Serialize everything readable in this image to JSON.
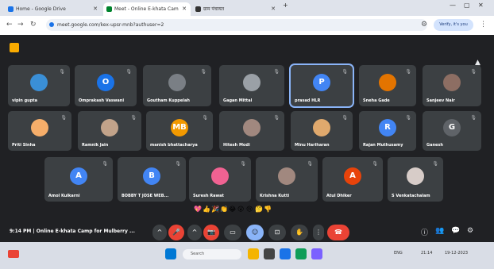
{
  "browser": {
    "tabs": [
      {
        "label": "Home - Google Drive",
        "fav_color": "#1a73e8"
      },
      {
        "label": "Meet - Online E-khata Cam",
        "fav_color": "#00832d"
      },
      {
        "label": "ग्राम पंचायत",
        "fav_color": "#333333"
      }
    ],
    "url": "meet.google.com/kex-upsr-mnb?authuser=2",
    "profile": "Verify, it's you"
  },
  "participants": [
    {
      "name": "vipin gupta",
      "initial": "",
      "color": "#3a8fd6"
    },
    {
      "name": "Omprakash Vaswani",
      "initial": "O",
      "color": "#1a73e8"
    },
    {
      "name": "Goutham Kuppelah",
      "initial": "",
      "color": "#7a7f85"
    },
    {
      "name": "Gagan Mittal",
      "initial": "",
      "color": "#9aa0a6"
    },
    {
      "name": "prasad HLR",
      "initial": "P",
      "color": "#4285f4"
    },
    {
      "name": "Sneha Gade",
      "initial": "",
      "color": "#e37400"
    },
    {
      "name": "Sanjeev Nair",
      "initial": "",
      "color": "#8d6e63"
    },
    {
      "name": "Priti Sinha",
      "initial": "",
      "color": "#f6ae6a"
    },
    {
      "name": "Ramnik Jain",
      "initial": "",
      "color": "#c2a38a"
    },
    {
      "name": "manish bhattacharya",
      "initial": "MB",
      "color": "#f29900"
    },
    {
      "name": "Hitesh Modi",
      "initial": "",
      "color": "#a1887f"
    },
    {
      "name": "Minu Hariharan",
      "initial": "",
      "color": "#e0a96d"
    },
    {
      "name": "Rajan Muthusamy",
      "initial": "R",
      "color": "#4285f4"
    },
    {
      "name": "Ganesh",
      "initial": "G",
      "color": "#5f6368"
    },
    {
      "name": "Amol Kulkarni",
      "initial": "A",
      "color": "#4285f4"
    },
    {
      "name": "BOBBY T JOSE WEB...",
      "initial": "B",
      "color": "#4285f4"
    },
    {
      "name": "Suresh Rawat",
      "initial": "",
      "color": "#f06292"
    },
    {
      "name": "Krishna Kutti",
      "initial": "",
      "color": "#a1887f"
    },
    {
      "name": "Atul Dhiker",
      "initial": "A",
      "color": "#e8430a"
    },
    {
      "name": "S Venkatachalam",
      "initial": "",
      "color": "#d7ccc8"
    }
  ],
  "reactions": [
    "💖",
    "👍",
    "🎉",
    "👏",
    "😂",
    "😮",
    "😢",
    "🤔",
    "👎"
  ],
  "bottombar": {
    "clock": "9:14 PM  |  Online E-khata Camp for Mulberry ...",
    "controls": [
      "^",
      "🎤",
      "^",
      "📷",
      "▭",
      "☺",
      "⊡",
      "✋",
      "⋮",
      "☎"
    ],
    "right": [
      "ⓘ",
      "👥",
      "💬",
      "⚙"
    ]
  },
  "taskbar": {
    "search": "Search",
    "tray_time": "21:14",
    "tray_date": "19-12-2023",
    "tray_lang": "ENG"
  }
}
